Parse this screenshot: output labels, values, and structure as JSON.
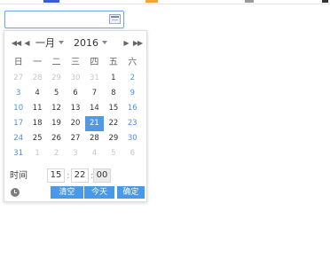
{
  "colors": {
    "input_border": "#7aa7e5",
    "weekend_text": "#4f8ee8",
    "selected_bg": "#4e9ae6",
    "button_bg": "#4a98e8",
    "muted_text": "#c7c7c7"
  },
  "browser_strip": {
    "marks": [
      "#365fd3",
      "#f0a43a",
      "#9c9c9c",
      "#333333"
    ]
  },
  "date_input": {
    "value": "",
    "placeholder": "",
    "icon": "calendar-icon"
  },
  "calendar": {
    "nav": {
      "prev_year": "◀◀",
      "prev_month": "◀",
      "month": "一月",
      "year": "2016",
      "next_month": "▶",
      "next_year": "▶▶"
    },
    "weekdays": [
      "日",
      "一",
      "二",
      "三",
      "四",
      "五",
      "六"
    ],
    "weeks": [
      [
        {
          "text": "27",
          "type": "muted"
        },
        {
          "text": "28",
          "type": "muted"
        },
        {
          "text": "29",
          "type": "muted"
        },
        {
          "text": "30",
          "type": "muted"
        },
        {
          "text": "31",
          "type": "muted"
        },
        {
          "text": "1",
          "type": "normal"
        },
        {
          "text": "2",
          "type": "weekend"
        }
      ],
      [
        {
          "text": "3",
          "type": "weekend"
        },
        {
          "text": "4",
          "type": "normal"
        },
        {
          "text": "5",
          "type": "normal"
        },
        {
          "text": "6",
          "type": "normal"
        },
        {
          "text": "7",
          "type": "normal"
        },
        {
          "text": "8",
          "type": "normal"
        },
        {
          "text": "9",
          "type": "weekend"
        }
      ],
      [
        {
          "text": "10",
          "type": "weekend"
        },
        {
          "text": "11",
          "type": "normal"
        },
        {
          "text": "12",
          "type": "normal"
        },
        {
          "text": "13",
          "type": "normal"
        },
        {
          "text": "14",
          "type": "normal"
        },
        {
          "text": "15",
          "type": "normal"
        },
        {
          "text": "16",
          "type": "weekend"
        }
      ],
      [
        {
          "text": "17",
          "type": "weekend"
        },
        {
          "text": "18",
          "type": "normal"
        },
        {
          "text": "19",
          "type": "normal"
        },
        {
          "text": "20",
          "type": "normal"
        },
        {
          "text": "21",
          "type": "selected"
        },
        {
          "text": "22",
          "type": "normal"
        },
        {
          "text": "23",
          "type": "weekend"
        }
      ],
      [
        {
          "text": "24",
          "type": "weekend"
        },
        {
          "text": "25",
          "type": "normal"
        },
        {
          "text": "26",
          "type": "normal"
        },
        {
          "text": "27",
          "type": "normal"
        },
        {
          "text": "28",
          "type": "normal"
        },
        {
          "text": "29",
          "type": "normal"
        },
        {
          "text": "30",
          "type": "weekend"
        }
      ],
      [
        {
          "text": "31",
          "type": "weekend"
        },
        {
          "text": "1",
          "type": "muted"
        },
        {
          "text": "2",
          "type": "muted"
        },
        {
          "text": "3",
          "type": "muted"
        },
        {
          "text": "4",
          "type": "muted"
        },
        {
          "text": "5",
          "type": "muted"
        },
        {
          "text": "6",
          "type": "muted"
        }
      ]
    ],
    "time": {
      "label": "时间",
      "hour": "15",
      "minute": "22",
      "second": "00",
      "separator": ":"
    },
    "footer": {
      "clear": "清空",
      "today": "今天",
      "confirm": "确定"
    }
  }
}
